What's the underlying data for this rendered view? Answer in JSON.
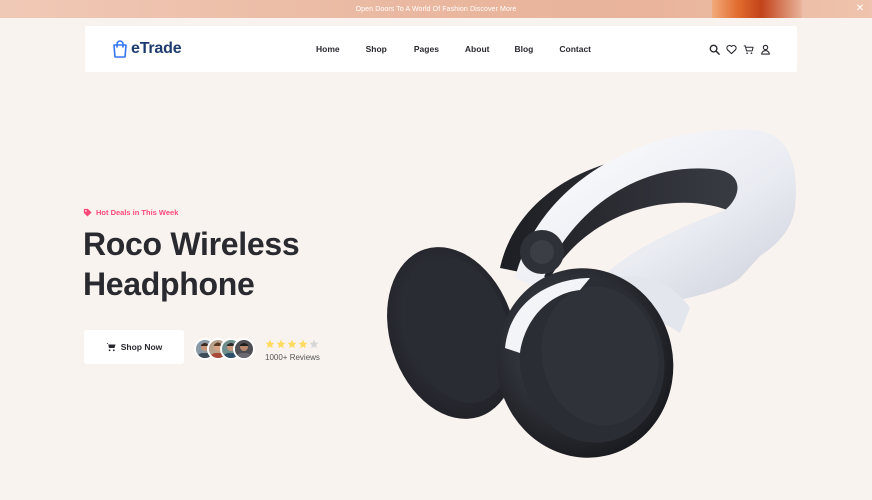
{
  "topbar": {
    "text": "Open Doors To A World Of Fashion Discover More",
    "close_icon": "close-icon"
  },
  "header": {
    "logo_text": "eTrade",
    "logo_icon": "shopping-bag-icon",
    "nav": [
      "Home",
      "Shop",
      "Pages",
      "About",
      "Blog",
      "Contact"
    ],
    "icons": [
      "search-icon",
      "heart-icon",
      "cart-icon",
      "user-icon"
    ]
  },
  "hero": {
    "tag": "Hot Deals in This Week",
    "tag_icon": "tag-icon",
    "title_line1": "Roco Wireless",
    "title_line2": "Headphone",
    "button_label": "Shop Now",
    "button_icon": "cart-icon",
    "rating": 4,
    "rating_max": 5,
    "reviews_text": "1000+ Reviews"
  },
  "colors": {
    "background": "#f9f3ef",
    "accent": "#ff497c",
    "logo": "#1e3b6e",
    "star": "#ffdc60",
    "star_empty": "#d6d6d6"
  }
}
